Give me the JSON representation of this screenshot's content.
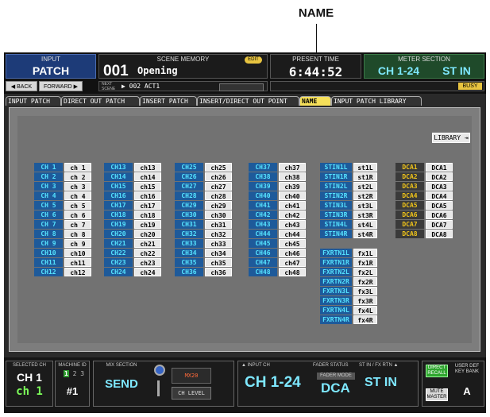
{
  "callout": {
    "label": "NAME"
  },
  "header": {
    "input": {
      "caption": "INPUT",
      "value": "PATCH"
    },
    "nav": {
      "back": "◀ BACK",
      "forward": "FORWARD ▶"
    },
    "scene_memory": {
      "caption": "SCENE MEMORY",
      "number": "001",
      "title": "Opening",
      "edit_badge": "EDIT"
    },
    "next_scene": {
      "caption": "NEXT SCENE",
      "value": "▶ 002 ACT1"
    },
    "present_time": {
      "caption": "PRESENT TIME",
      "value": "6:44:52"
    },
    "meter_section": {
      "caption": "METER SECTION",
      "range": "CH 1-24",
      "stin": "ST IN"
    },
    "status": {
      "busy": "BUSY"
    }
  },
  "tabs": [
    {
      "label": "INPUT PATCH",
      "active": false
    },
    {
      "label": "DIRECT OUT PATCH",
      "active": false
    },
    {
      "label": "INSERT PATCH",
      "active": false
    },
    {
      "label": "INSERT/DIRECT OUT POINT",
      "active": false
    },
    {
      "label": "NAME",
      "active": true
    },
    {
      "label": "INPUT PATCH LIBRARY",
      "active": false
    }
  ],
  "library_button": "LIBRARY ⇥",
  "columns": [
    {
      "rows": [
        [
          "CH 1",
          "ch 1"
        ],
        [
          "CH 2",
          "ch 2"
        ],
        [
          "CH 3",
          "ch 3"
        ],
        [
          "CH 4",
          "ch 4"
        ],
        [
          "CH 5",
          "ch 5"
        ],
        [
          "CH 6",
          "ch 6"
        ],
        [
          "CH 7",
          "ch 7"
        ],
        [
          "CH 8",
          "ch 8"
        ],
        [
          "CH 9",
          "ch 9"
        ],
        [
          "CH10",
          "ch10"
        ],
        [
          "CH11",
          "ch11"
        ],
        [
          "CH12",
          "ch12"
        ]
      ]
    },
    {
      "rows": [
        [
          "CH13",
          "ch13"
        ],
        [
          "CH14",
          "ch14"
        ],
        [
          "CH15",
          "ch15"
        ],
        [
          "CH16",
          "ch16"
        ],
        [
          "CH17",
          "ch17"
        ],
        [
          "CH18",
          "ch18"
        ],
        [
          "CH19",
          "ch19"
        ],
        [
          "CH20",
          "ch20"
        ],
        [
          "CH21",
          "ch21"
        ],
        [
          "CH22",
          "ch22"
        ],
        [
          "CH23",
          "ch23"
        ],
        [
          "CH24",
          "ch24"
        ]
      ]
    },
    {
      "rows": [
        [
          "CH25",
          "ch25"
        ],
        [
          "CH26",
          "ch26"
        ],
        [
          "CH27",
          "ch27"
        ],
        [
          "CH28",
          "ch28"
        ],
        [
          "CH29",
          "ch29"
        ],
        [
          "CH30",
          "ch30"
        ],
        [
          "CH31",
          "ch31"
        ],
        [
          "CH32",
          "ch32"
        ],
        [
          "CH33",
          "ch33"
        ],
        [
          "CH34",
          "ch34"
        ],
        [
          "CH35",
          "ch35"
        ],
        [
          "CH36",
          "ch36"
        ]
      ]
    },
    {
      "rows": [
        [
          "CH37",
          "ch37"
        ],
        [
          "CH38",
          "ch38"
        ],
        [
          "CH39",
          "ch39"
        ],
        [
          "CH40",
          "ch40"
        ],
        [
          "CH41",
          "ch41"
        ],
        [
          "CH42",
          "ch42"
        ],
        [
          "CH43",
          "ch43"
        ],
        [
          "CH44",
          "ch44"
        ],
        [
          "CH45",
          "ch45"
        ],
        [
          "CH46",
          "ch46"
        ],
        [
          "CH47",
          "ch47"
        ],
        [
          "CH48",
          "ch48"
        ]
      ]
    },
    {
      "rows": [
        [
          "STIN1L",
          "st1L"
        ],
        [
          "STIN1R",
          "st1R"
        ],
        [
          "STIN2L",
          "st2L"
        ],
        [
          "STIN2R",
          "st2R"
        ],
        [
          "STIN3L",
          "st3L"
        ],
        [
          "STIN3R",
          "st3R"
        ],
        [
          "STIN4L",
          "st4L"
        ],
        [
          "STIN4R",
          "st4R"
        ],
        [
          "",
          ""
        ],
        [
          "FXRTN1L",
          "fx1L"
        ],
        [
          "FXRTN1R",
          "fx1R"
        ],
        [
          "FXRTN2L",
          "fx2L"
        ],
        [
          "FXRTN2R",
          "fx2R"
        ],
        [
          "FXRTN3L",
          "fx3L"
        ],
        [
          "FXRTN3R",
          "fx3R"
        ],
        [
          "FXRTN4L",
          "fx4L"
        ],
        [
          "FXRTN4R",
          "fx4R"
        ]
      ]
    },
    {
      "rows": [
        [
          "DCA1",
          "DCA1"
        ],
        [
          "DCA2",
          "DCA2"
        ],
        [
          "DCA3",
          "DCA3"
        ],
        [
          "DCA4",
          "DCA4"
        ],
        [
          "DCA5",
          "DCA5"
        ],
        [
          "DCA6",
          "DCA6"
        ],
        [
          "DCA7",
          "DCA7"
        ],
        [
          "DCA8",
          "DCA8"
        ]
      ]
    }
  ],
  "bottom": {
    "selected_ch": {
      "caption": "SELECTED CH",
      "value": "CH 1",
      "name": "ch 1"
    },
    "machine_id": {
      "caption": "MACHINE ID",
      "ids": "1 2 3",
      "value": "#1"
    },
    "mix_section": {
      "caption": "MIX SECTION",
      "value": "SEND",
      "mix": "MX20",
      "ch_level": "CH LEVEL"
    },
    "input_ch": {
      "caption": "▲ INPUT CH",
      "value": "CH 1-24"
    },
    "fader_status": {
      "caption": "FADER STATUS",
      "mode_label": "FADER MODE",
      "value": "DCA"
    },
    "stin_fxrtn": {
      "caption": "ST IN / FX RTN ▲",
      "value": "ST IN"
    },
    "direct_recall": "DIRECT RECALL",
    "mute_master": "MUTE MASTER",
    "user_def": {
      "caption": "USER DEF KEY BANK",
      "value": "A"
    }
  },
  "colors": {
    "label_bg": "#1e5a9a",
    "label_text": "#55e3ff",
    "dca_text": "#f0c419",
    "tab_active": "#f6e05a"
  }
}
